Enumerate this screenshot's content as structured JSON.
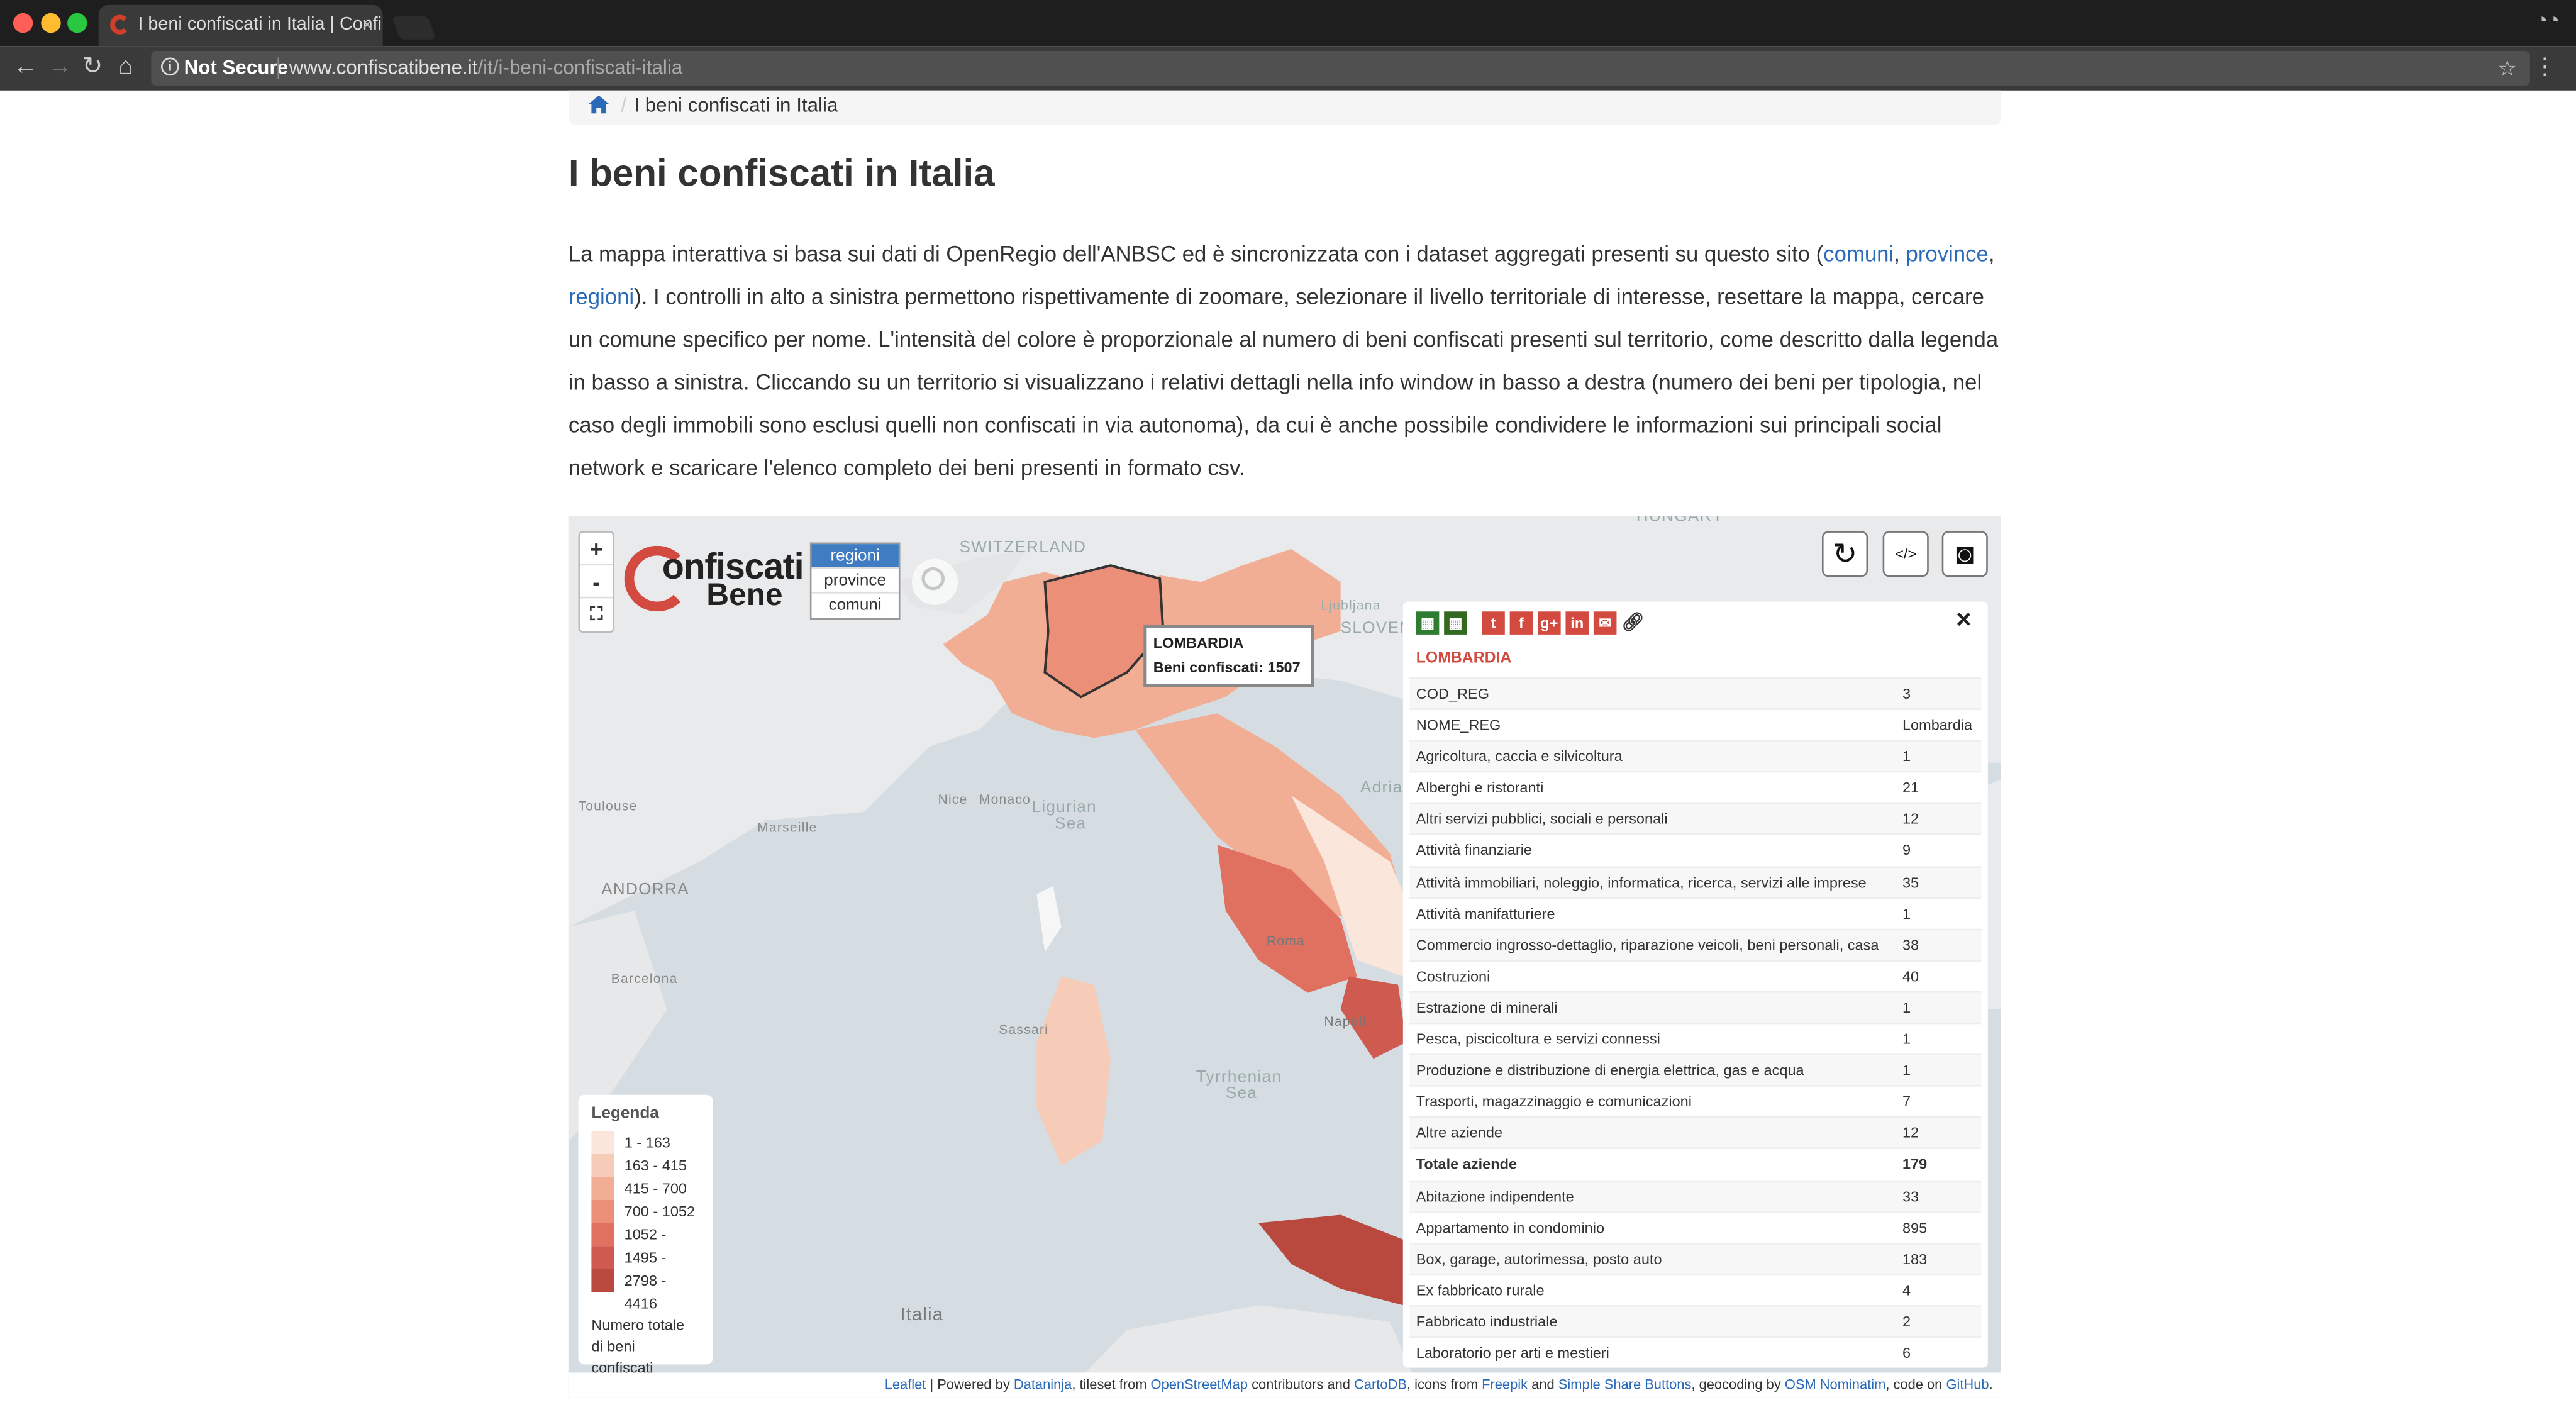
{
  "browser": {
    "tab_title": "I beni confiscati in Italia | Confi",
    "tab_close": "×",
    "not_secure": "Not Secure",
    "url_host": "www.confiscatibene.it",
    "url_path": "/it/i-beni-confiscati-italia"
  },
  "breadcrumb": {
    "separator": "/",
    "current": "I beni confiscati in Italia"
  },
  "page": {
    "title": "I beni confiscati in Italia",
    "intro_1": "La mappa interattiva si basa sui dati di OpenRegio dell'ANBSC ed è sincronizzata con i dataset aggregati presenti su questo sito (",
    "link_comuni": "comuni",
    "sep_comma": ", ",
    "link_province": "province",
    "sep_comma2": ",",
    "link_regioni": "regioni",
    "intro_2": "). I controlli in alto a sinistra permettono rispettivamente di zoomare, selezionare il livello territoriale di interesse, resettare la mappa, cercare un comune specifico per nome. L'intensità del colore è proporzionale al numero di beni confiscati presenti sul territorio, come descritto dalla legenda in basso a sinistra. Cliccando su un territorio si visualizzano i relativi dettagli nella info window in basso a destra (numero dei beni per tipologia, nel caso degli immobili sono esclusi quelli non confiscati in via autonoma), da cui è anche possibile condividere le informazioni sui principali social network e scaricare l'elenco completo dei beni presenti in formato csv."
  },
  "map": {
    "zoom_in": "+",
    "zoom_out": "-",
    "logo_line1": "onfiscati",
    "logo_line2": "Bene",
    "levels": [
      "regioni",
      "province",
      "comuni"
    ],
    "selected_level": "regioni",
    "basemap_labels": [
      "SWITZERLAND",
      "HUNGARY",
      "SLOVEN",
      "Ljubljana",
      "Toulouse",
      "Marseille",
      "Nice",
      "Monaco",
      "Ligurian",
      "Sea",
      "ANDORRA",
      "Barcelona",
      "Adriatic",
      "Roma",
      "Napoli",
      "Sassari",
      "Tyrrhenian",
      "Sea",
      "Italia"
    ],
    "tooltip": {
      "region": "LOMBARDIA",
      "label": "Beni confiscati: 1507"
    },
    "legend": {
      "title": "Legenda",
      "classes": [
        {
          "range": "1 - 163",
          "color": "#fbe6dc"
        },
        {
          "range": "163 - 415",
          "color": "#f6cbb7"
        },
        {
          "range": "415 - 700",
          "color": "#f1ae95"
        },
        {
          "range": "700 - 1052",
          "color": "#eb8f78"
        },
        {
          "range": "1052 - 1495",
          "color": "#e0705f"
        },
        {
          "range": "1495 - 2798",
          "color": "#cf5a4f"
        },
        {
          "range": "2798 - 4416",
          "color": "#b9483f"
        }
      ],
      "footer_1": "Numero totale",
      "footer_2": "di beni confiscati"
    },
    "info": {
      "close": "×",
      "title": "LOMBARDIA",
      "rows": [
        {
          "k": "COD_REG",
          "v": "3"
        },
        {
          "k": "NOME_REG",
          "v": "Lombardia"
        },
        {
          "k": "Agricoltura, caccia e silvicoltura",
          "v": "1"
        },
        {
          "k": "Alberghi e ristoranti",
          "v": "21"
        },
        {
          "k": "Altri servizi pubblici, sociali e personali",
          "v": "12"
        },
        {
          "k": "Attività finanziarie",
          "v": "9"
        },
        {
          "k": "Attività immobiliari, noleggio, informatica, ricerca, servizi alle imprese",
          "v": "35"
        },
        {
          "k": "Attività manifatturiere",
          "v": "1"
        },
        {
          "k": "Commercio ingrosso-dettaglio, riparazione veicoli, beni personali, casa",
          "v": "38"
        },
        {
          "k": "Costruzioni",
          "v": "40"
        },
        {
          "k": "Estrazione di minerali",
          "v": "1"
        },
        {
          "k": "Pesca, piscicoltura e servizi connessi",
          "v": "1"
        },
        {
          "k": "Produzione e distribuzione di energia elettrica, gas e acqua",
          "v": "1"
        },
        {
          "k": "Trasporti, magazzinaggio e comunicazioni",
          "v": "7"
        },
        {
          "k": "Altre aziende",
          "v": "12"
        },
        {
          "k": "Totale aziende",
          "v": "179",
          "bold": true
        },
        {
          "k": "Abitazione indipendente",
          "v": "33"
        },
        {
          "k": "Appartamento in condominio",
          "v": "895"
        },
        {
          "k": "Box, garage, autorimessa, posto auto",
          "v": "183"
        },
        {
          "k": "Ex fabbricato rurale",
          "v": "4"
        },
        {
          "k": "Fabbricato industriale",
          "v": "2"
        },
        {
          "k": "Laboratorio per arti e mestieri",
          "v": "6"
        }
      ]
    },
    "attribution": {
      "leaflet": "Leaflet",
      "t1": " | Powered by ",
      "datanija": "Dataninja",
      "t2": ", tileset from ",
      "osm": "OpenStreetMap",
      "t3": " contributors and ",
      "cartodb": "CartoDB",
      "t4": ", icons from ",
      "freepik": "Freepik",
      "t5": " and ",
      "ssb": "Simple Share Buttons",
      "t6": ", geocoding by ",
      "nominatim": "OSM Nominatim",
      "t7": ", code on ",
      "github": "GitHub",
      "t8": "."
    }
  }
}
